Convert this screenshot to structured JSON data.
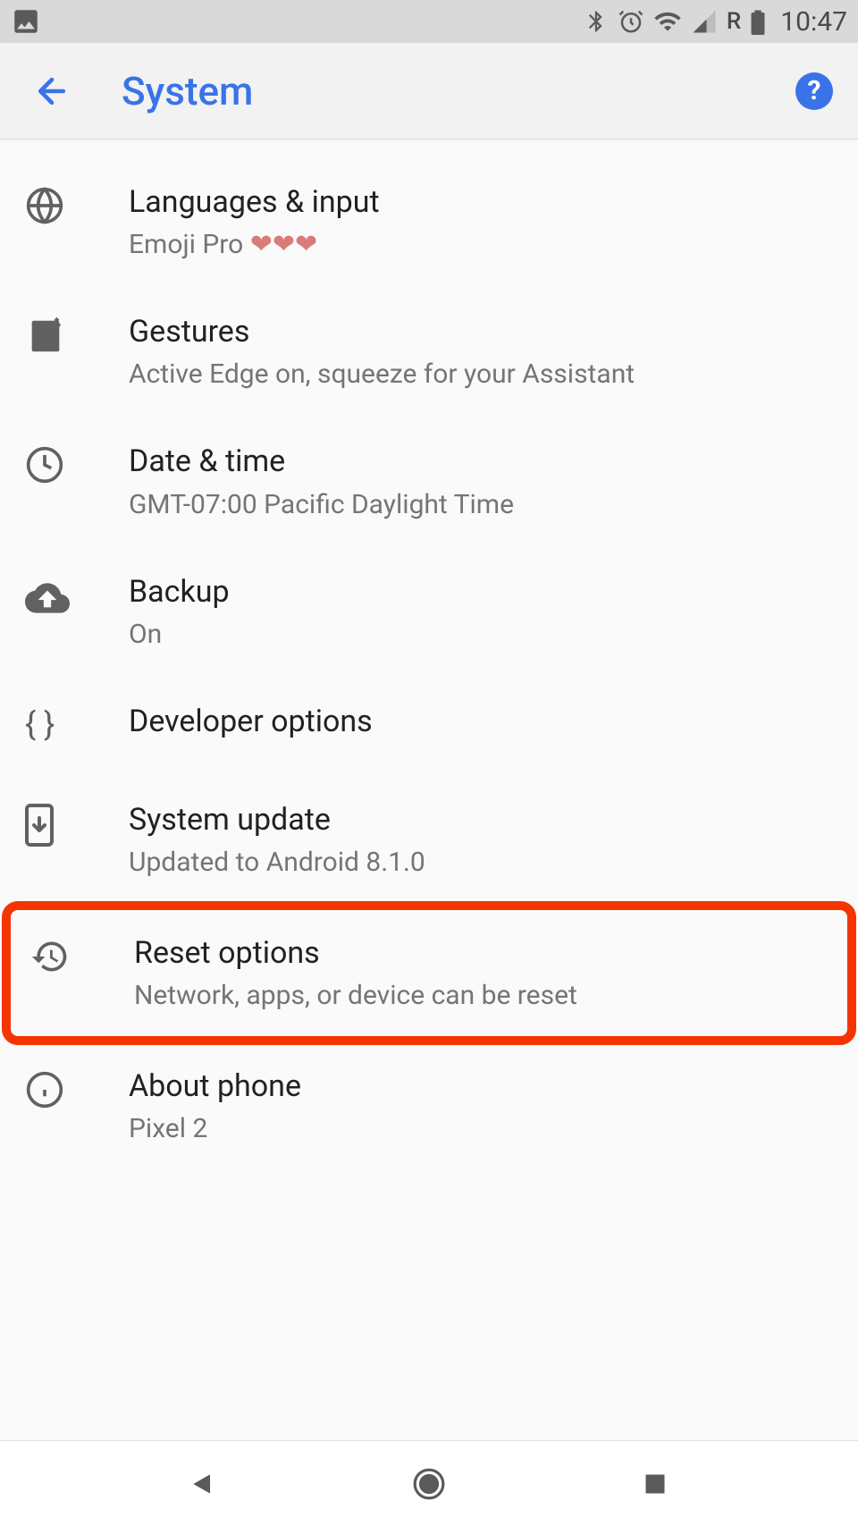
{
  "statusBar": {
    "time": "10:47",
    "roaming": "R"
  },
  "appBar": {
    "title": "System"
  },
  "items": [
    {
      "icon": "globe",
      "title": "Languages & input",
      "subtitle": "Emoji Pro ",
      "hearts": "❤❤❤",
      "highlighted": false
    },
    {
      "icon": "gestures",
      "title": "Gestures",
      "subtitle": "Active Edge on, squeeze for your Assistant",
      "highlighted": false
    },
    {
      "icon": "clock",
      "title": "Date & time",
      "subtitle": "GMT-07:00 Pacific Daylight Time",
      "highlighted": false
    },
    {
      "icon": "cloud-upload",
      "title": "Backup",
      "subtitle": "On",
      "highlighted": false
    },
    {
      "icon": "braces",
      "title": "Developer options",
      "subtitle": "",
      "highlighted": false
    },
    {
      "icon": "phone-download",
      "title": "System update",
      "subtitle": "Updated to Android 8.1.0",
      "highlighted": false
    },
    {
      "icon": "restore",
      "title": "Reset options",
      "subtitle": "Network, apps, or device can be reset",
      "highlighted": true
    },
    {
      "icon": "info",
      "title": "About phone",
      "subtitle": "Pixel 2",
      "highlighted": false
    }
  ]
}
